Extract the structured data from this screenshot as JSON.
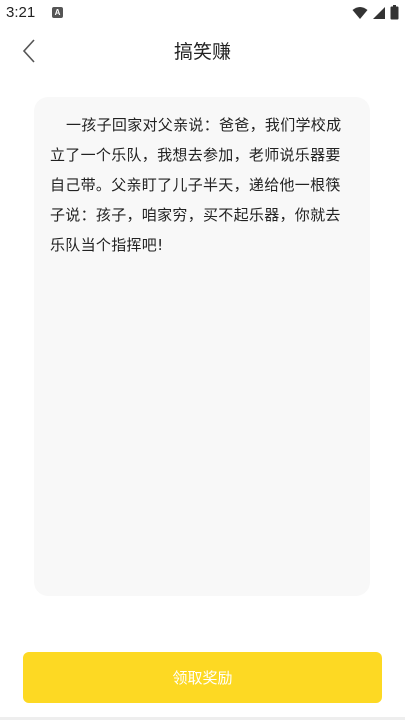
{
  "status_bar": {
    "time": "3:21",
    "notification_badge": "A"
  },
  "nav": {
    "title": "搞笑赚"
  },
  "content": {
    "joke_text": "一孩子回家对父亲说：爸爸，我们学校成立了一个乐队，我想去参加，老师说乐器要自己带。父亲盯了儿子半天，递给他一根筷子说：孩子，咱家穷，买不起乐器，你就去乐队当个指挥吧!"
  },
  "actions": {
    "reward_label": "领取奖励"
  },
  "colors": {
    "accent": "#fdd923",
    "card_bg": "#f8f8f8"
  }
}
